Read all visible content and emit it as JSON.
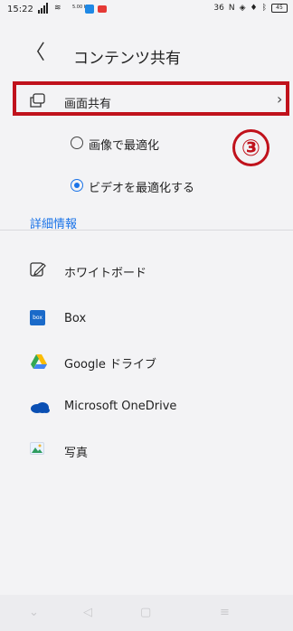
{
  "status_bar": {
    "time": "15:22",
    "small_text": "5.00 KB/s",
    "right_text": "36",
    "battery": "45"
  },
  "header": {
    "title": "コンテンツ共有",
    "back_icon": "chevron-left"
  },
  "screen_share": {
    "label": "画面共有",
    "icon": "screen-share-icon",
    "highlight_color": "#c0121c"
  },
  "annotation_badge": "③",
  "options": [
    {
      "label": "画像で最適化",
      "selected": false
    },
    {
      "label": "ビデオを最適化する",
      "selected": true
    }
  ],
  "details_link": "詳細情報",
  "sources": [
    {
      "label": "ホワイトボード",
      "icon": "whiteboard-icon"
    },
    {
      "label": "Box",
      "icon": "box-icon"
    },
    {
      "label": "Google ドライブ",
      "icon": "google-drive-icon"
    },
    {
      "label": "Microsoft OneDrive",
      "icon": "onedrive-icon"
    },
    {
      "label": "写真",
      "icon": "photos-icon"
    }
  ],
  "accent_color": "#1a73e8"
}
